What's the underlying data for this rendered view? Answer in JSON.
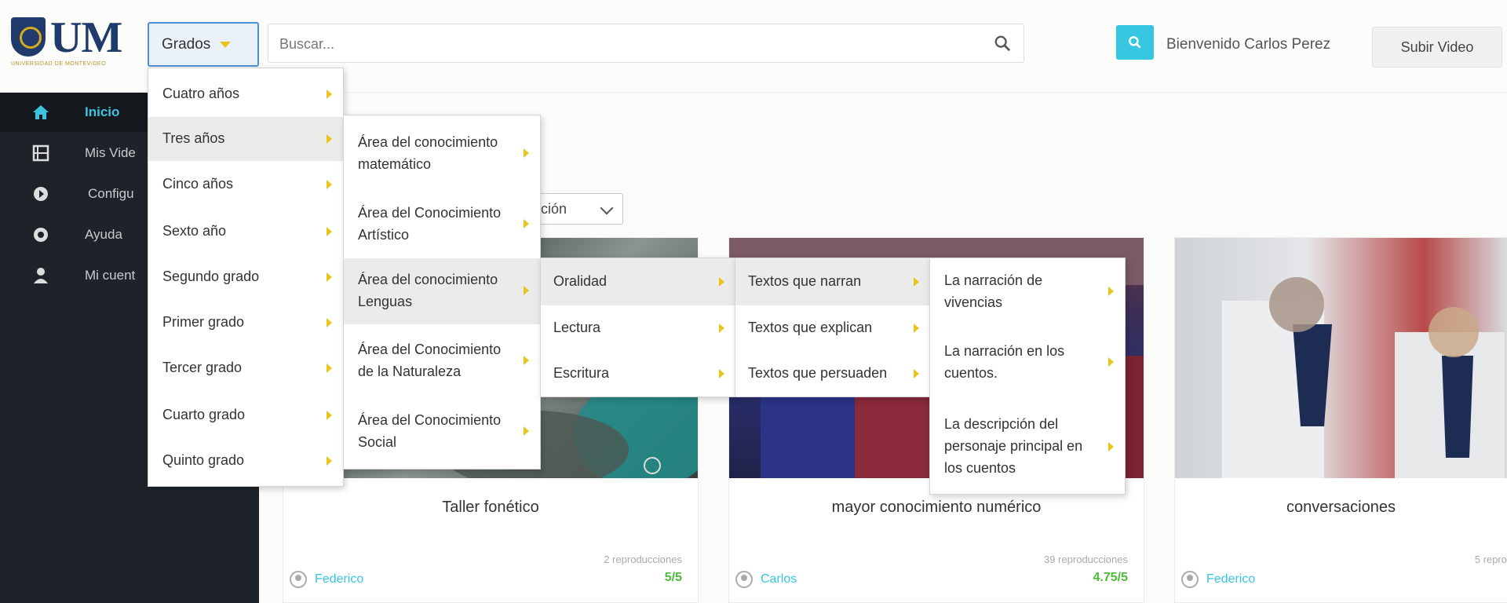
{
  "header": {
    "logo_text": "UM",
    "logo_subtitle": "UNIVERSIDAD DE MONTEVIDEO",
    "grados_label": "Grados",
    "search_placeholder": "Buscar...",
    "welcome_text": "Bienvenido Carlos Perez",
    "upload_label": "Subir Video"
  },
  "sidebar": {
    "items": [
      {
        "label": "Inicio",
        "icon": "home-icon"
      },
      {
        "label": "Mis Vide",
        "icon": "film-icon"
      },
      {
        "label": "Configu",
        "icon": "gear-icon"
      },
      {
        "label": "Ayuda",
        "icon": "help-icon"
      },
      {
        "label": "Mi cuent",
        "icon": "user-icon"
      }
    ]
  },
  "sort": {
    "label": "ción"
  },
  "menus": {
    "level1": [
      "Cuatro años",
      "Tres años",
      "Cinco años",
      "Sexto año",
      "Segundo grado",
      "Primer grado",
      "Tercer grado",
      "Cuarto grado",
      "Quinto grado"
    ],
    "level2": [
      {
        "line1": "Área del conocimiento",
        "line2": "matemático"
      },
      {
        "line1": "Área del Conocimiento",
        "line2": "Artístico"
      },
      {
        "line1": "Área del conocimiento",
        "line2": "Lenguas"
      },
      {
        "line1": "Área del Conocimiento",
        "line2": "de la Naturaleza"
      },
      {
        "line1": "Área del Conocimiento",
        "line2": "Social"
      }
    ],
    "level3": [
      "Oralidad",
      "Lectura",
      "Escritura"
    ],
    "level4": [
      "Textos que narran",
      "Textos que explican",
      "Textos que persuaden"
    ],
    "level5": [
      {
        "line1": "La narración de",
        "line2": "vivencias",
        "line3": ""
      },
      {
        "line1": "La narración en los",
        "line2": "cuentos.",
        "line3": ""
      },
      {
        "line1": "La descripción del",
        "line2": "personaje principal en",
        "line3": "los cuentos"
      }
    ]
  },
  "cards": [
    {
      "title": "Taller fonético",
      "views": "2 reproducciones",
      "author": "Federico",
      "rating": "5/5"
    },
    {
      "title": "mayor conocimiento numérico",
      "views": "39 reproducciones",
      "author": "Carlos",
      "rating": "4.75/5"
    },
    {
      "title": "conversaciones",
      "views": "5 repro",
      "author": "Federico",
      "rating": ""
    }
  ],
  "colors": {
    "accent": "#36c6e0",
    "sidebar": "#1e2329",
    "rating": "#4cbb3a",
    "arrow": "#e7c51d",
    "logo": "#1f3a6b"
  }
}
